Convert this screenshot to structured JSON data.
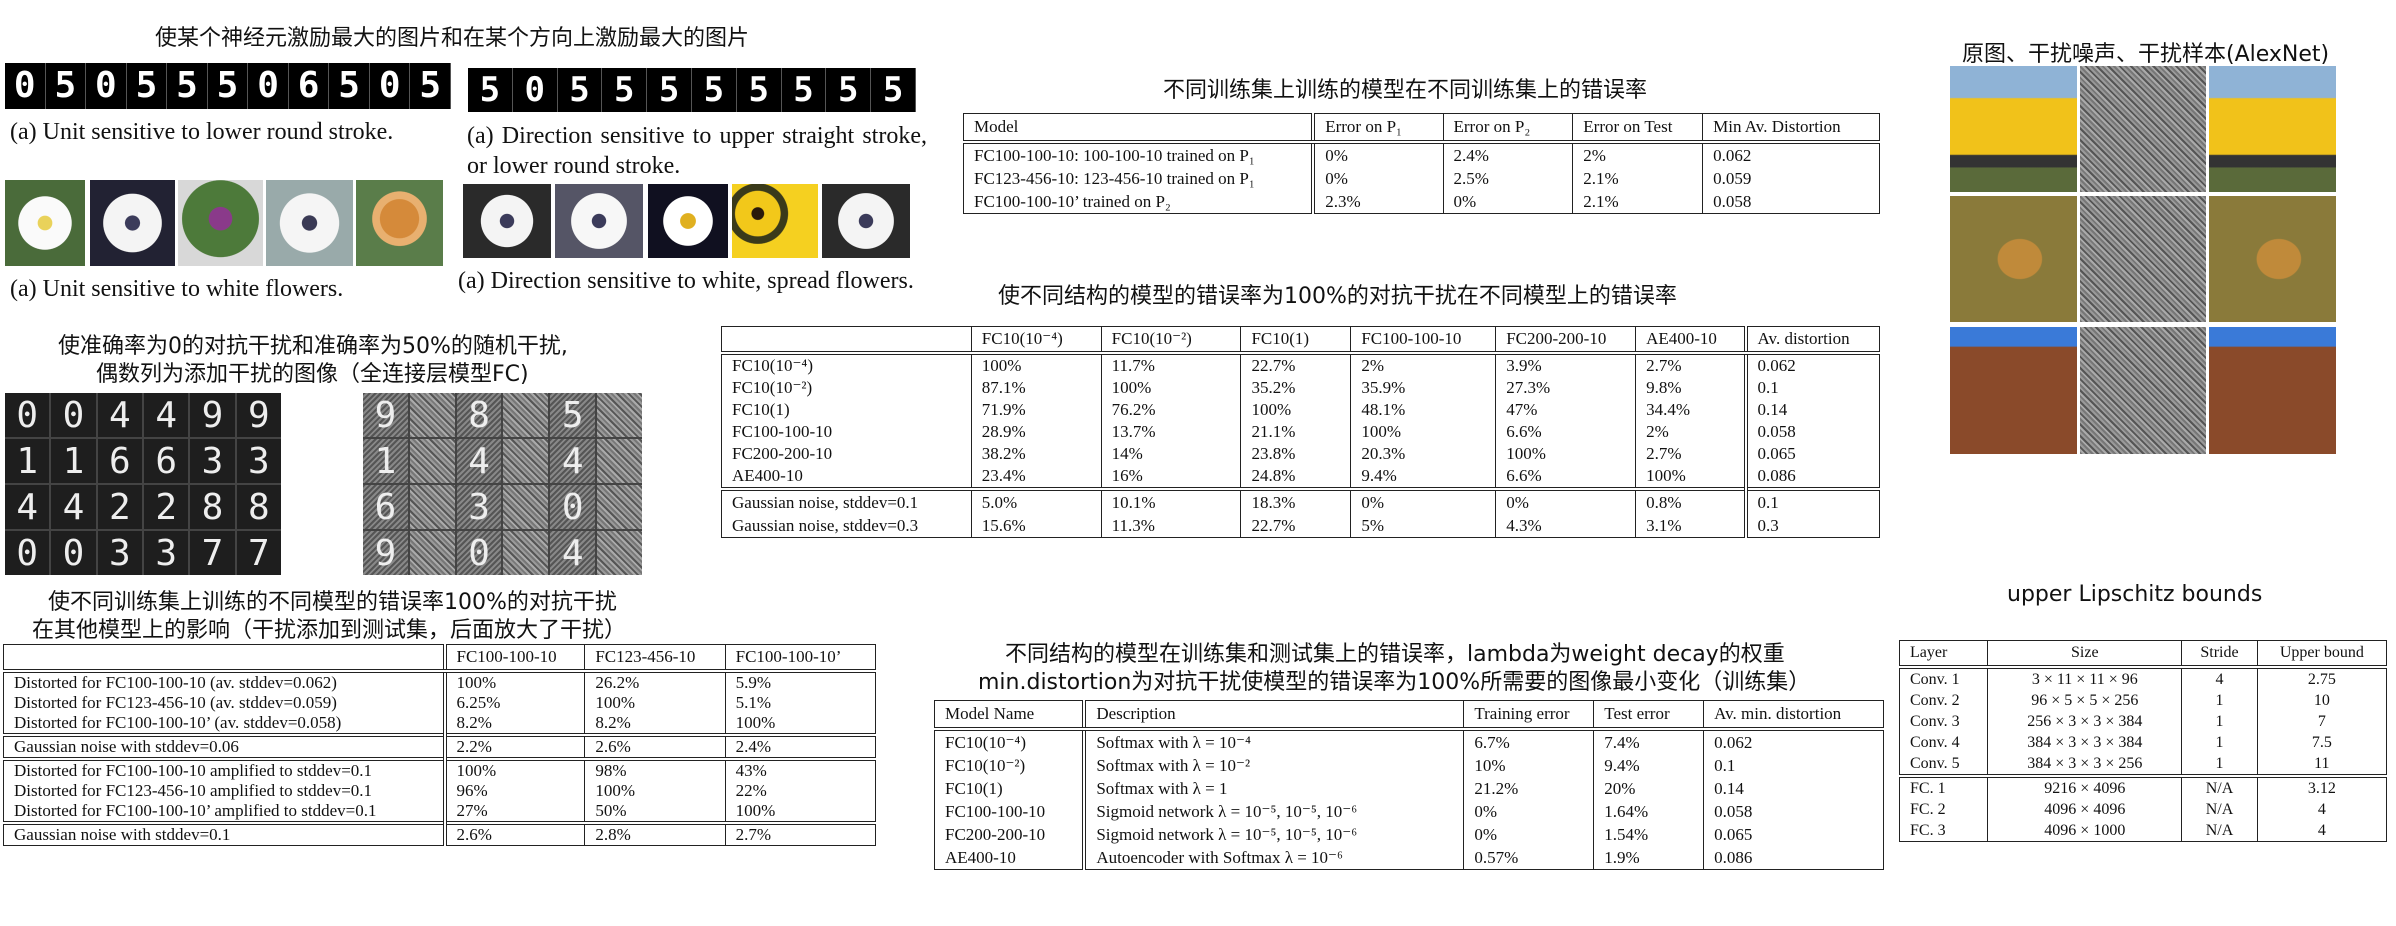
{
  "top_left_title": "使某个神经元激励最大的图片和在某个方向上激励最大的图片",
  "mnist_a": [
    "0",
    "5",
    "0",
    "5",
    "5",
    "5",
    "0",
    "6",
    "5",
    "0",
    "5"
  ],
  "mnist_b": [
    "5",
    "0",
    "5",
    "5",
    "5",
    "5",
    "5",
    "5",
    "5",
    "5"
  ],
  "caption_a1": "(a) Unit sensitive to lower round stroke.",
  "caption_b1": "(a) Direction sensitive to upper straight stroke, or lower round stroke.",
  "caption_a2": "(a) Unit sensitive to white flowers.",
  "caption_b2": "(a) Direction sensitive to white, spread flowers.",
  "adv_title_1": "使准确率为0的对抗干扰和准确率为50%的随机干扰,",
  "adv_title_2": "偶数列为添加干扰的图像（全连接层模型FC)",
  "adv_left_digits": [
    "0",
    "0",
    "4",
    "4",
    "9",
    "9",
    "1",
    "1",
    "6",
    "6",
    "3",
    "3",
    "4",
    "4",
    "2",
    "2",
    "8",
    "8",
    "0",
    "0",
    "3",
    "3",
    "7",
    "7"
  ],
  "adv_right_digits": [
    "9",
    "",
    "8",
    "",
    "5",
    "",
    "1",
    "",
    "4",
    "",
    "4",
    "",
    "6",
    "",
    "3",
    "",
    "0",
    "",
    "9",
    "",
    "0",
    "",
    "4",
    ""
  ],
  "table1": {
    "title_1": "使不同训练集上训练的不同模型的错误率100%的对抗干扰",
    "title_2": "在其他模型上的影响（干扰添加到测试集，后面放大了干扰）",
    "headers": [
      "",
      "FC100-100-10",
      "FC123-456-10",
      "FC100-100-10’"
    ],
    "group1": [
      [
        "Distorted for FC100-100-10 (av. stddev=0.062)",
        "100%",
        "26.2%",
        "5.9%"
      ],
      [
        "Distorted for FC123-456-10 (av. stddev=0.059)",
        "6.25%",
        "100%",
        "5.1%"
      ],
      [
        "Distorted for FC100-100-10’ (av. stddev=0.058)",
        "8.2%",
        "8.2%",
        "100%"
      ]
    ],
    "group2": [
      [
        "Gaussian noise with stddev=0.06",
        "2.2%",
        "2.6%",
        "2.4%"
      ]
    ],
    "group3": [
      [
        "Distorted for FC100-100-10 amplified to stddev=0.1",
        "100%",
        "98%",
        "43%"
      ],
      [
        "Distorted for FC123-456-10 amplified to stddev=0.1",
        "96%",
        "100%",
        "22%"
      ],
      [
        "Distorted for FC100-100-10’ amplified to stddev=0.1",
        "27%",
        "50%",
        "100%"
      ]
    ],
    "group4": [
      [
        "Gaussian noise with stddev=0.1",
        "2.6%",
        "2.8%",
        "2.7%"
      ]
    ]
  },
  "table2": {
    "title": "不同训练集上训练的模型在不同训练集上的错误率",
    "headers": [
      "Model",
      "Error on P₁",
      "Error on P₂",
      "Error on Test",
      "Min Av. Distortion"
    ],
    "rows": [
      [
        "FC100-100-10: 100-100-10 trained on P₁",
        "0%",
        "2.4%",
        "2%",
        "0.062"
      ],
      [
        "FC123-456-10: 123-456-10 trained on P₁",
        "0%",
        "2.5%",
        "2.1%",
        "0.059"
      ],
      [
        "FC100-100-10’ trained on P₂",
        "2.3%",
        "0%",
        "2.1%",
        "0.058"
      ]
    ]
  },
  "table3": {
    "title": "使不同结构的模型的错误率为100%的对抗干扰在不同模型上的错误率",
    "headers": [
      "",
      "FC10(10⁻⁴)",
      "FC10(10⁻²)",
      "FC10(1)",
      "FC100-100-10",
      "FC200-200-10",
      "AE400-10",
      "Av. distortion"
    ],
    "rows": [
      [
        "FC10(10⁻⁴)",
        "100%",
        "11.7%",
        "22.7%",
        "2%",
        "3.9%",
        "2.7%",
        "0.062"
      ],
      [
        "FC10(10⁻²)",
        "87.1%",
        "100%",
        "35.2%",
        "35.9%",
        "27.3%",
        "9.8%",
        "0.1"
      ],
      [
        "FC10(1)",
        "71.9%",
        "76.2%",
        "100%",
        "48.1%",
        "47%",
        "34.4%",
        "0.14"
      ],
      [
        "FC100-100-10",
        "28.9%",
        "13.7%",
        "21.1%",
        "100%",
        "6.6%",
        "2%",
        "0.058"
      ],
      [
        "FC200-200-10",
        "38.2%",
        "14%",
        "23.8%",
        "20.3%",
        "100%",
        "2.7%",
        "0.065"
      ],
      [
        "AE400-10",
        "23.4%",
        "16%",
        "24.8%",
        "9.4%",
        "6.6%",
        "100%",
        "0.086"
      ]
    ],
    "noise_rows": [
      [
        "Gaussian noise, stddev=0.1",
        "5.0%",
        "10.1%",
        "18.3%",
        "0%",
        "0%",
        "0.8%",
        "0.1"
      ],
      [
        "Gaussian noise, stddev=0.3",
        "15.6%",
        "11.3%",
        "22.7%",
        "5%",
        "4.3%",
        "3.1%",
        "0.3"
      ]
    ]
  },
  "table4": {
    "title_1": "不同结构的模型在训练集和测试集上的错误率，lambda为weight decay的权重",
    "title_2": "min.distortion为对抗干扰使模型的错误率为100%所需要的图像最小变化（训练集）",
    "headers": [
      "Model Name",
      "Description",
      "Training error",
      "Test error",
      "Av. min. distortion"
    ],
    "rows": [
      [
        "FC10(10⁻⁴)",
        "Softmax with λ = 10⁻⁴",
        "6.7%",
        "7.4%",
        "0.062"
      ],
      [
        "FC10(10⁻²)",
        "Softmax with λ = 10⁻²",
        "10%",
        "9.4%",
        "0.1"
      ],
      [
        "FC10(1)",
        "Softmax with λ = 1",
        "21.2%",
        "20%",
        "0.14"
      ],
      [
        "FC100-100-10",
        "Sigmoid network λ = 10⁻⁵, 10⁻⁵, 10⁻⁶",
        "0%",
        "1.64%",
        "0.058"
      ],
      [
        "FC200-200-10",
        "Sigmoid network λ = 10⁻⁵, 10⁻⁵, 10⁻⁶",
        "0%",
        "1.54%",
        "0.065"
      ],
      [
        "AE400-10",
        "Autoencoder with Softmax λ = 10⁻⁶",
        "0.57%",
        "1.9%",
        "0.086"
      ]
    ]
  },
  "alexnet_title": "原图、干扰噪声、干扰样本(AlexNet)",
  "table5": {
    "title": "upper Lipschitz bounds",
    "headers": [
      "Layer",
      "Size",
      "Stride",
      "Upper bound"
    ],
    "conv_rows": [
      [
        "Conv. 1",
        "3 × 11 × 11 × 96",
        "4",
        "2.75"
      ],
      [
        "Conv. 2",
        "96 × 5 × 5 × 256",
        "1",
        "10"
      ],
      [
        "Conv. 3",
        "256 × 3 × 3 × 384",
        "1",
        "7"
      ],
      [
        "Conv. 4",
        "384 × 3 × 3 × 384",
        "1",
        "7.5"
      ],
      [
        "Conv. 5",
        "384 × 3 × 3 × 256",
        "1",
        "11"
      ]
    ],
    "fc_rows": [
      [
        "FC. 1",
        "9216 × 4096",
        "N/A",
        "3.12"
      ],
      [
        "FC. 2",
        "4096 × 4096",
        "N/A",
        "4"
      ],
      [
        "FC. 3",
        "4096 × 1000",
        "N/A",
        "4"
      ]
    ]
  }
}
